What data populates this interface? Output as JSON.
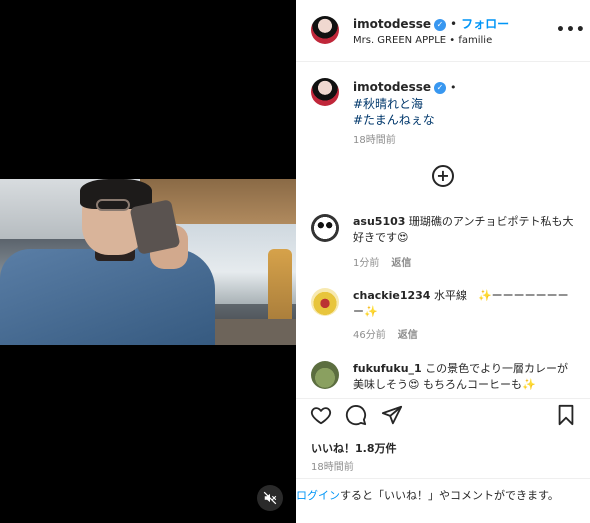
{
  "header": {
    "username": "imotodesse",
    "follow_label": "フォロー",
    "subtitle": "Mrs. GREEN APPLE • familie",
    "more_label": "•••"
  },
  "caption": {
    "username": "imotodesse",
    "hashtags": [
      "#秋晴れと海",
      "#たまんねぇな"
    ],
    "time": "18時間前"
  },
  "comments": [
    {
      "username": "asu5103",
      "text": "珊瑚礁のアンチョビポテト私も大好きです😍",
      "time": "1分前",
      "reply_label": "返信"
    },
    {
      "username": "chackie1234",
      "text": "水平線　✨ーーーーーーーー✨",
      "time": "46分前",
      "reply_label": "返信"
    },
    {
      "username": "fukufuku_1",
      "text": "この景色でより一層カレーが美味しそう😍 もちろんコーヒーも✨"
    }
  ],
  "likes": "いいね！1.8万件",
  "post_time": "18時間前",
  "login_prompt": {
    "link": "ログイン",
    "rest": "すると「いいね！」やコメントができます。"
  },
  "icons": {
    "verified": "verified-badge-icon",
    "add_comment": "plus-circle-icon",
    "like": "heart-icon",
    "comment": "comment-bubble-icon",
    "share": "paper-plane-icon",
    "save": "bookmark-icon",
    "mute": "speaker-muted-icon"
  }
}
